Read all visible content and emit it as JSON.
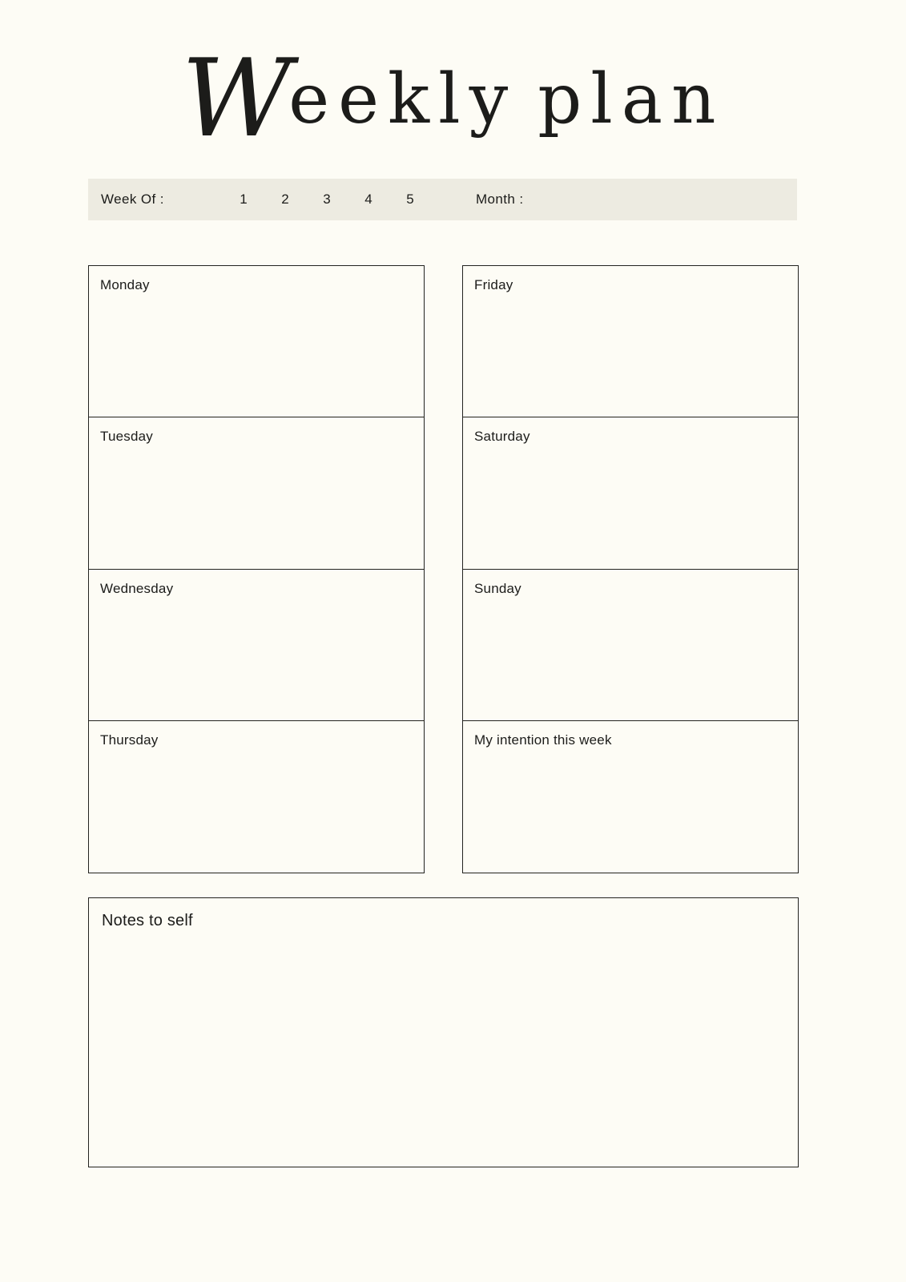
{
  "page": {
    "background_color": "#FDFCF5",
    "ink_color": "#1C1C1A",
    "border_color": "#232320"
  },
  "title": {
    "initial": "W",
    "first_word_rest": "eekly",
    "second_word": "plan",
    "full_text": "Weekly plan"
  },
  "week_header": {
    "background_color": "#EDEBE1",
    "week_of_label": "Week Of :",
    "week_numbers": [
      "1",
      "2",
      "3",
      "4",
      "5"
    ],
    "month_label": "Month :"
  },
  "columns": {
    "left": [
      {
        "label": "Monday"
      },
      {
        "label": "Tuesday"
      },
      {
        "label": "Wednesday"
      },
      {
        "label": "Thursday"
      }
    ],
    "right": [
      {
        "label": "Friday"
      },
      {
        "label": "Saturday"
      },
      {
        "label": "Sunday"
      },
      {
        "label": "My intention this week"
      }
    ]
  },
  "notes": {
    "label": "Notes to self"
  }
}
